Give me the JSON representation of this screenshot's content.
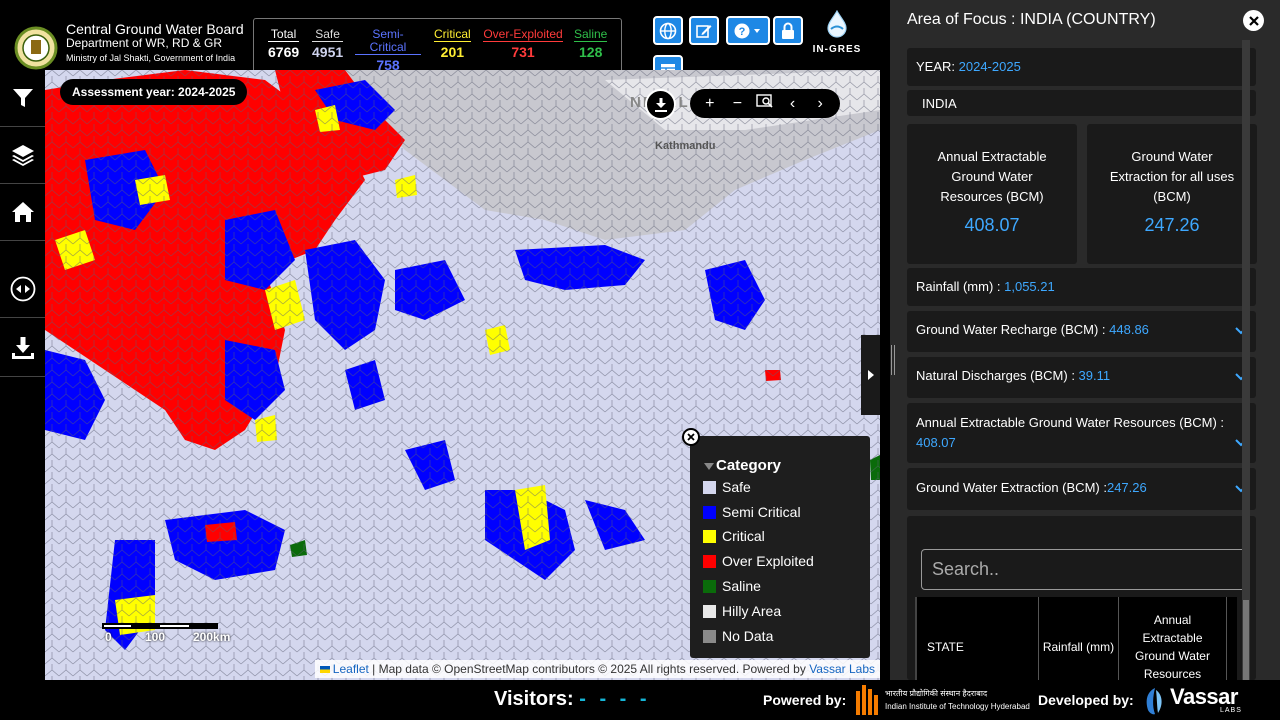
{
  "header": {
    "org_name": "Central Ground Water Board",
    "org_dept": "Department of WR, RD & GR",
    "org_ministry": "Ministry of Jal Shakti, Government of India",
    "app_logo_text": "IN-GRES"
  },
  "stats": {
    "total_label": "Total",
    "total_value": "6769",
    "safe_label": "Safe",
    "safe_value": "4951",
    "semi_label": "Semi-Critical",
    "semi_value": "758",
    "critical_label": "Critical",
    "critical_value": "201",
    "over_label": "Over-Exploited",
    "over_value": "731",
    "saline_label": "Saline",
    "saline_value": "128"
  },
  "colors": {
    "safe": "#d4d7ee",
    "semi_critical": "#0000ff",
    "critical": "#ffff00",
    "over_exploited": "#ff0000",
    "saline": "#0a6b0a",
    "hilly": "#e8e8e8",
    "no_data": "#8a8a8a",
    "accent_blue": "#3ea8ff",
    "button_blue": "#1e88e5"
  },
  "map": {
    "assessment_label": "Assessment year: 2024-2025",
    "place_nepal": "NEPAL",
    "place_kathmandu": "Kathmandu",
    "scale_0": "0",
    "scale_100": "100",
    "scale_200": "200km",
    "attribution_leaflet": "Leaflet",
    "attribution_text": " | Map data © OpenStreetMap contributors © 2025 All rights reserved. Powered by ",
    "attribution_vassar": "Vassar Labs"
  },
  "legend": {
    "title": "Category",
    "items": [
      {
        "label": "Safe",
        "color": "#d4d7ee"
      },
      {
        "label": "Semi Critical",
        "color": "#0000ff"
      },
      {
        "label": "Critical",
        "color": "#ffff00"
      },
      {
        "label": "Over Exploited",
        "color": "#ff0000"
      },
      {
        "label": "Saline",
        "color": "#0a6b0a"
      },
      {
        "label": "Hilly Area",
        "color": "#e8e8e8"
      },
      {
        "label": "No Data",
        "color": "#8a8a8a"
      }
    ]
  },
  "panel": {
    "heading": "Area of Focus : INDIA (COUNTRY)",
    "year_label": "YEAR: ",
    "year_value": "2024-2025",
    "region": "INDIA",
    "card1_title": "Annual Extractable Ground Water Resources (BCM)",
    "card1_value": "408.07",
    "card2_title": "Ground Water Extraction for all uses (BCM)",
    "card2_value": "247.26",
    "rainfall_label": "Rainfall (mm) : ",
    "rainfall_value": "1,055.21",
    "recharge_label": "Ground Water Recharge (BCM) : ",
    "recharge_value": "448.86",
    "discharge_label": "Natural Discharges (BCM) : ",
    "discharge_value": "39.11",
    "extractable_label": "Annual Extractable Ground Water Resources (BCM) :",
    "extractable_value": "408.07",
    "extraction_label": "Ground Water Extraction (BCM) :",
    "extraction_value": "247.26",
    "search_placeholder": "Search..",
    "table_headers": [
      "STATE",
      "Rainfall (mm)",
      "Annual Extractable Ground Water Resources"
    ]
  },
  "footer": {
    "visitors_label": "Visitors:",
    "visitors_value": "- - - -",
    "powered_label": "Powered by:",
    "iith_hindi": "भारतीय प्रौद्योगिकी संस्थान हैदराबाद",
    "iith_english": "Indian Institute of Technology Hyderabad",
    "developed_label": "Developed by:",
    "vassar_name": "Vassar",
    "vassar_sub": "LABS"
  }
}
